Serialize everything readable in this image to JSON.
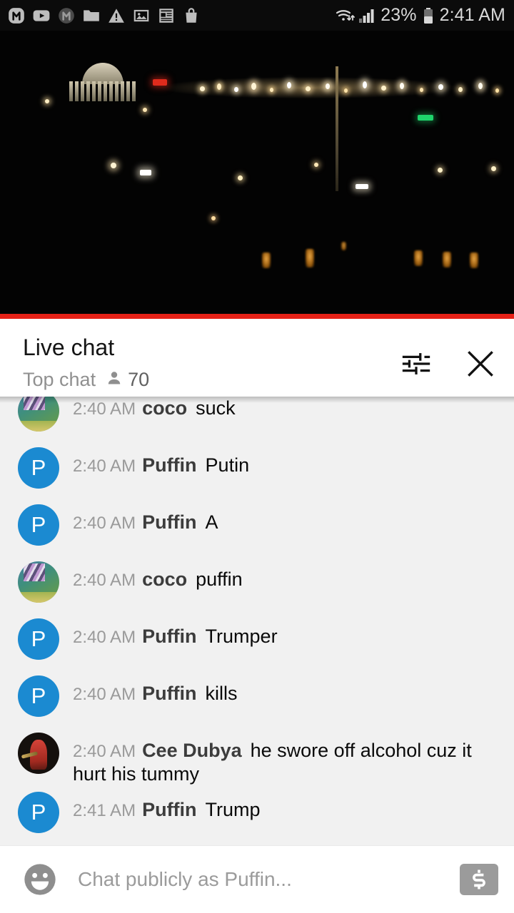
{
  "status_bar": {
    "notification_icons": [
      "messenger-m-icon",
      "youtube-icon",
      "muted-m-icon",
      "folder-icon",
      "warning-triangle-icon",
      "photo-icon",
      "news-icon",
      "shopping-bag-icon"
    ],
    "wifi_icon": "wifi-transfer-icon",
    "signal_icon": "cell-signal-icon",
    "battery_percent": "23%",
    "battery_icon": "battery-icon",
    "time": "2:41 AM"
  },
  "player": {
    "progress_color": "#e62117",
    "progress_percent": 100,
    "scene": "night-city-skyline-with-memorial"
  },
  "chat_header": {
    "title": "Live chat",
    "mode_label": "Top chat",
    "viewer_icon": "person-icon",
    "viewer_count": "70",
    "settings_icon": "tune-sliders-icon",
    "close_icon": "close-icon"
  },
  "messages": [
    {
      "time": "2:40 AM",
      "author": "coco",
      "text": "suck",
      "avatar_type": "photo",
      "avatar_class": "av-coco",
      "initial": ""
    },
    {
      "time": "2:40 AM",
      "author": "Puffin",
      "text": "Putin",
      "avatar_type": "initial",
      "avatar_class": "av-puffin",
      "initial": "P"
    },
    {
      "time": "2:40 AM",
      "author": "Puffin",
      "text": "A",
      "avatar_type": "initial",
      "avatar_class": "av-puffin",
      "initial": "P"
    },
    {
      "time": "2:40 AM",
      "author": "coco",
      "text": "puffin",
      "avatar_type": "photo",
      "avatar_class": "av-coco",
      "initial": ""
    },
    {
      "time": "2:40 AM",
      "author": "Puffin",
      "text": "Trumper",
      "avatar_type": "initial",
      "avatar_class": "av-puffin",
      "initial": "P"
    },
    {
      "time": "2:40 AM",
      "author": "Puffin",
      "text": "kills",
      "avatar_type": "initial",
      "avatar_class": "av-puffin",
      "initial": "P"
    },
    {
      "time": "2:40 AM",
      "author": "Cee Dubya",
      "text": "he swore off alcohol cuz it hurt his tummy",
      "avatar_type": "photo",
      "avatar_class": "av-cee",
      "initial": ""
    },
    {
      "time": "2:41 AM",
      "author": "Puffin",
      "text": "Trump",
      "avatar_type": "initial",
      "avatar_class": "av-puffin",
      "initial": "P"
    }
  ],
  "composer": {
    "emoji_icon": "emoji-smiley-icon",
    "placeholder": "Chat publicly as Puffin...",
    "value": "",
    "superchat_icon": "dollar-superchat-icon"
  },
  "colors": {
    "puffin_avatar": "#1b8ad1",
    "accent_red": "#e62117",
    "chat_background": "#f1f1f1",
    "status_bar": "#0b0b0b"
  }
}
